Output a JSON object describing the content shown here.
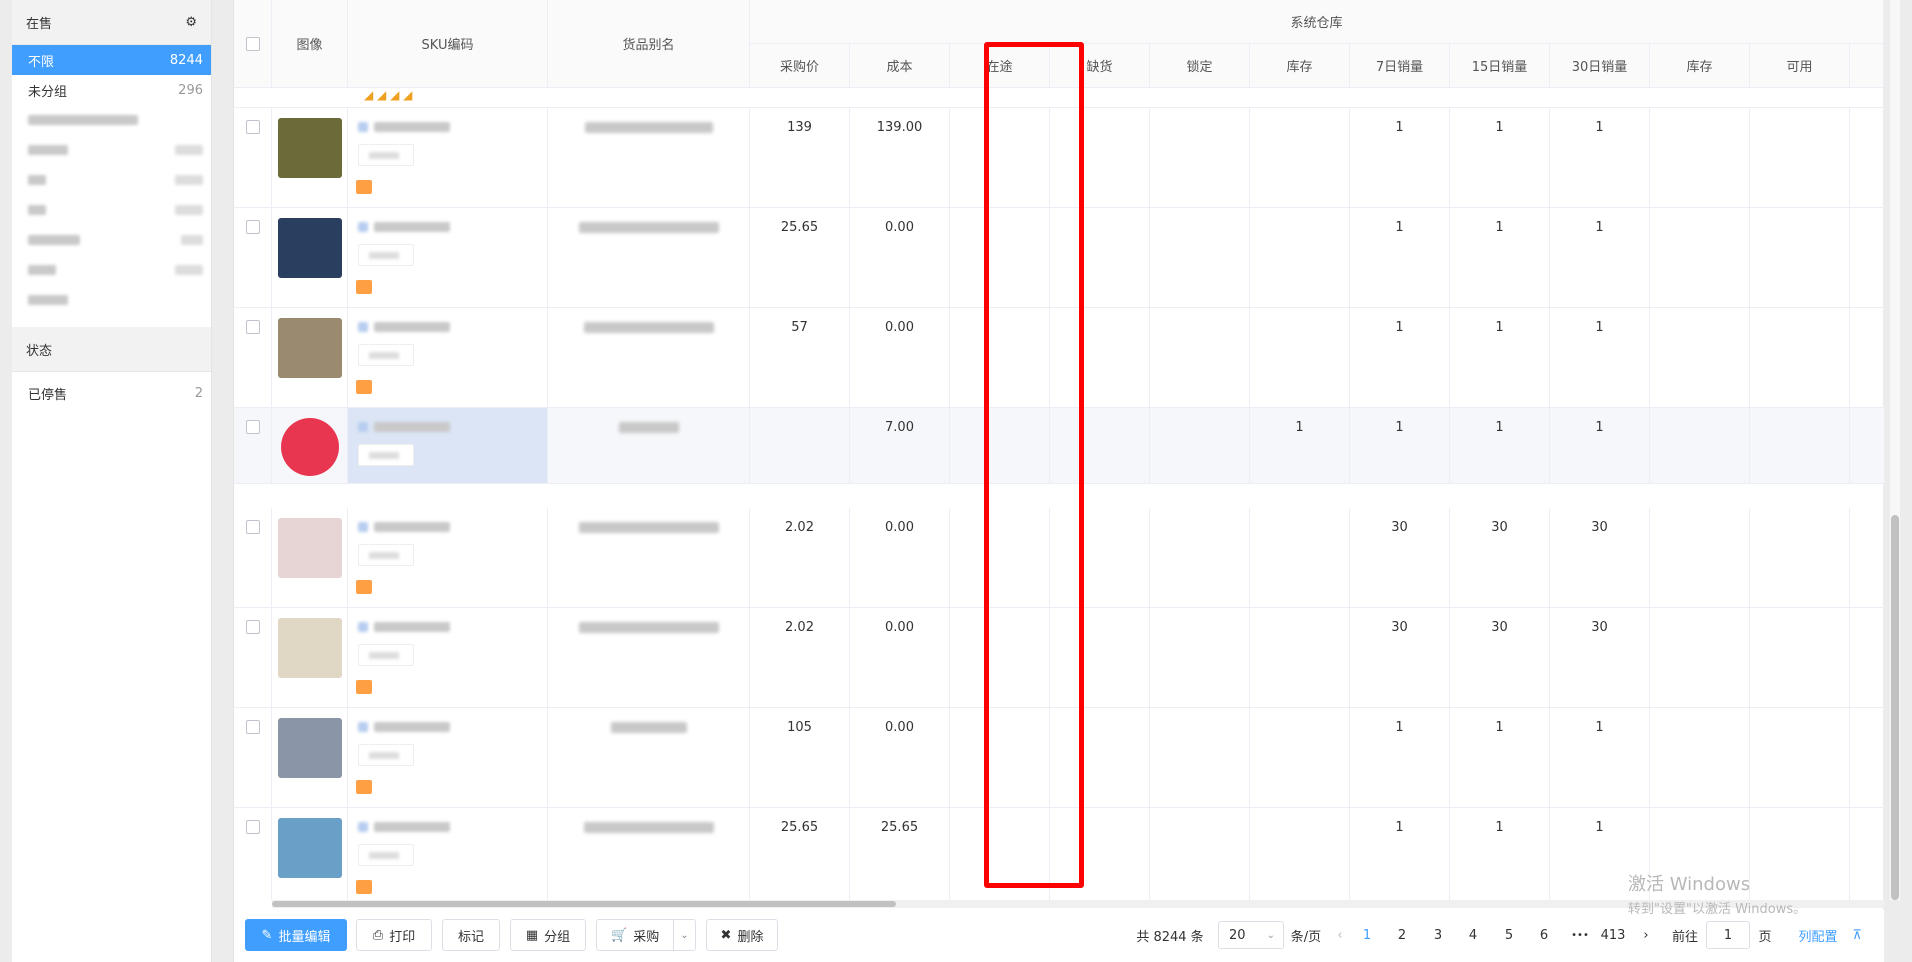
{
  "sidebar": {
    "section_title": "在售",
    "items": [
      {
        "label": "不限",
        "count": "8244",
        "active": true
      },
      {
        "label": "未分组",
        "count": "296"
      }
    ],
    "status_title": "状态",
    "status_items": [
      {
        "label": "已停售",
        "count": "2"
      }
    ]
  },
  "table": {
    "group_header": "系统仓库",
    "headers": {
      "image": "图像",
      "sku": "SKU编码",
      "alias": "货品别名",
      "purchase_price": "采购价",
      "cost": "成本",
      "in_transit": "在途",
      "shortage": "缺货",
      "locked": "锁定",
      "stock": "库存",
      "sales7": "7日销量",
      "sales15": "15日销量",
      "sales30": "30日销量",
      "stock2": "库存",
      "available": "可用"
    },
    "rows": [
      {
        "price": "139",
        "cost": "139.00",
        "stock": "",
        "s7": "1",
        "s15": "1",
        "s30": "1",
        "img": "#6b6b3a"
      },
      {
        "price": "25.65",
        "cost": "0.00",
        "stock": "",
        "s7": "1",
        "s15": "1",
        "s30": "1",
        "img": "#2a3f5f"
      },
      {
        "price": "57",
        "cost": "0.00",
        "stock": "",
        "s7": "1",
        "s15": "1",
        "s30": "1",
        "img": "#9a8a70"
      },
      {
        "price": "",
        "cost": "7.00",
        "stock": "1",
        "s7": "1",
        "s15": "1",
        "s30": "1",
        "img": "#e83550"
      },
      {
        "price": "2.02",
        "cost": "0.00",
        "stock": "",
        "s7": "30",
        "s15": "30",
        "s30": "30",
        "img": "#e7d4d4"
      },
      {
        "price": "2.02",
        "cost": "0.00",
        "stock": "",
        "s7": "30",
        "s15": "30",
        "s30": "30",
        "img": "#e0d8c4"
      },
      {
        "price": "105",
        "cost": "0.00",
        "stock": "",
        "s7": "1",
        "s15": "1",
        "s30": "1",
        "img": "#8a96a8"
      },
      {
        "price": "25.65",
        "cost": "25.65",
        "stock": "",
        "s7": "1",
        "s15": "1",
        "s30": "1",
        "img": "#6aa0c8"
      }
    ]
  },
  "toolbar": {
    "batch_edit": "批量编辑",
    "print": "打印",
    "mark": "标记",
    "group": "分组",
    "purchase": "采购",
    "delete": "删除"
  },
  "pagination": {
    "total": "共 8244 条",
    "page_size": "20",
    "per_page": "条/页",
    "pages": [
      "1",
      "2",
      "3",
      "4",
      "5",
      "6"
    ],
    "ellipsis": "•••",
    "last_page": "413",
    "goto_label": "前往",
    "goto_value": "1",
    "page_unit": "页",
    "column_config": "列配置",
    "top_icon": "⊼"
  },
  "watermark": {
    "line1": "激活 Windows",
    "line2": "转到\"设置\"以激活 Windows。"
  }
}
